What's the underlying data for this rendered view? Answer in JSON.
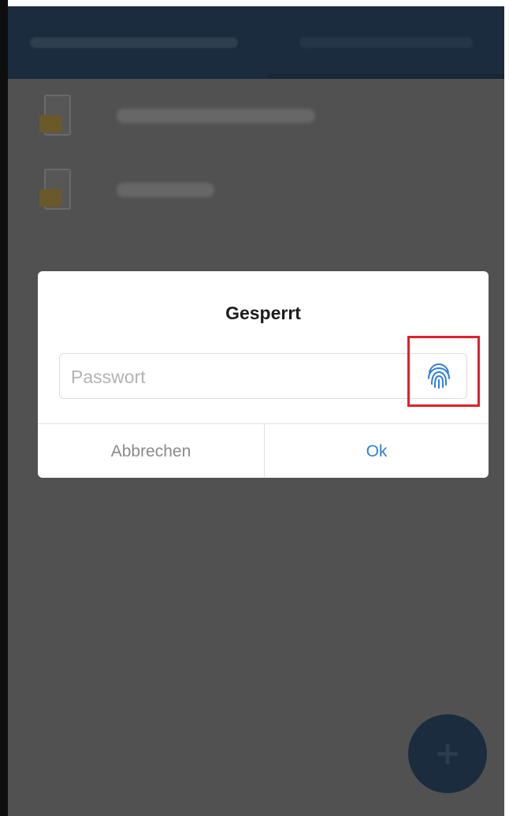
{
  "colors": {
    "overlay_bg": "#515151",
    "appbar_bg": "#1a2c3d",
    "dialog_bg": "#ffffff",
    "ok_text": "#2f7fd6",
    "cancel_text": "#8a8a8a",
    "highlight": "#e0202a",
    "fingerprint_icon": "#2f7fd6"
  },
  "dialog": {
    "title": "Gesperrt",
    "password_placeholder": "Passwort",
    "password_value": "",
    "fingerprint_icon": "fingerprint-icon",
    "cancel_label": "Abbrechen",
    "ok_label": "Ok"
  },
  "fab": {
    "icon": "plus-icon"
  }
}
